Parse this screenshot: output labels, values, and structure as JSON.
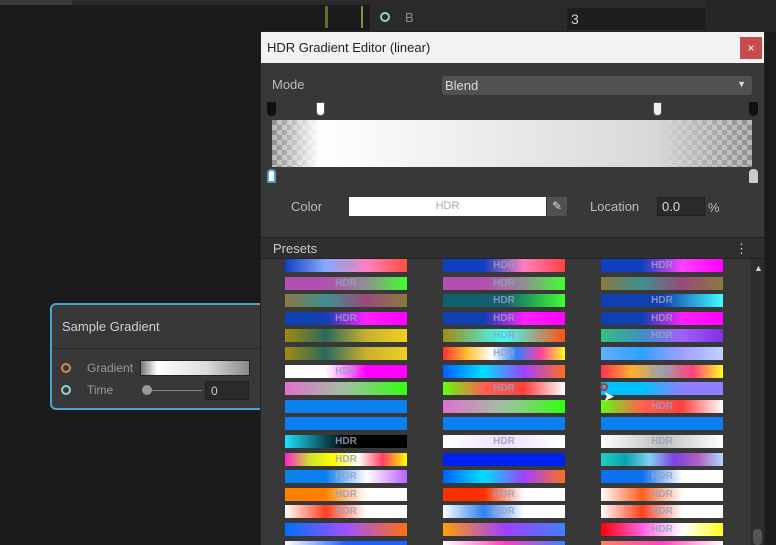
{
  "inspector": {
    "port_label": "B",
    "value": "3"
  },
  "node": {
    "title": "Sample Gradient",
    "inputs": [
      {
        "label": "Gradient",
        "port_color": "#d98a4a"
      },
      {
        "label": "Time",
        "port_color": "#8fd3d0",
        "value": "0"
      }
    ]
  },
  "editor": {
    "title": "HDR Gradient Editor (linear)",
    "close_icon": "×",
    "mode_label": "Mode",
    "mode_value": "Blend",
    "color_label": "Color",
    "color_value_text": "HDR",
    "color_value": "#ffffff",
    "location_label": "Location",
    "location_value": "0.0",
    "location_unit": "%",
    "presets_label": "Presets",
    "presets_menu_icon": "⋮",
    "gradient_colors": [
      "#ffffff",
      "#d8d8d8"
    ],
    "alpha_keys": [
      0,
      10,
      80,
      100
    ],
    "color_keys": [
      0,
      100
    ]
  },
  "presets": [
    [
      {
        "c": [
          "#1040c0",
          "#88a8ff",
          "#ff80c0",
          "#ff5040"
        ],
        "h": "HDR"
      },
      {
        "c": [
          "#1040c0",
          "#1040c0",
          "#ff80c0",
          "#ff4040"
        ],
        "h": "HDR"
      },
      {
        "c": [
          "#1040c0",
          "#1040c0",
          "#ff40ff",
          "#ff00ff"
        ],
        "h": "HDR"
      }
    ],
    [
      {
        "c": [
          "#b050b0",
          "#b050b0",
          "#909090",
          "#40ff30"
        ],
        "h": "HDR"
      },
      {
        "c": [
          "#b050b0",
          "#b050b0",
          "#909090",
          "#40ff30"
        ],
        "h": "HDR"
      },
      {
        "c": [
          "#8a7a40",
          "#3f8f8f",
          "#9a4a7a",
          "#8a7a40"
        ],
        "h": ""
      }
    ],
    [
      {
        "c": [
          "#8a7a40",
          "#3f8f8f",
          "#9a4a7a",
          "#8a7a40"
        ],
        "h": ""
      },
      {
        "c": [
          "#106070",
          "#106070",
          "#40ff30"
        ],
        "h": "HDR"
      },
      {
        "c": [
          "#1040b0",
          "#1040b0",
          "#40ffff"
        ],
        "h": "HDR"
      }
    ],
    [
      {
        "c": [
          "#1040b0",
          "#1040b0",
          "#ff20ff",
          "#ff00ff"
        ],
        "h": "HDR"
      },
      {
        "c": [
          "#1040b0",
          "#1040b0",
          "#ff20ff",
          "#ff00ff"
        ],
        "h": "HDR"
      },
      {
        "c": [
          "#1040b0",
          "#1040b0",
          "#ff20ff",
          "#ff00ff"
        ],
        "h": "HDR"
      }
    ],
    [
      {
        "c": [
          "#a08a10",
          "#2a6a5a",
          "#c8b030",
          "#f0d020"
        ],
        "h": ""
      },
      {
        "c": [
          "#a08a10",
          "#40ffff",
          "#ff5010"
        ],
        "h": "HDR"
      },
      {
        "c": [
          "#30c080",
          "#4090c0",
          "#a060ff",
          "#8030e0"
        ],
        "h": "HDR"
      }
    ],
    [
      {
        "c": [
          "#a08a10",
          "#2a6a5a",
          "#c8b030",
          "#f0d020"
        ],
        "h": ""
      },
      {
        "c": [
          "#ff3030",
          "#ffc030",
          "#ffffff",
          "#3080ff",
          "#ff40a0",
          "#ffff20"
        ],
        "h": "HDR"
      },
      {
        "c": [
          "#60b0ff",
          "#30a0ff",
          "#a0a0ff",
          "#c0d0ff"
        ],
        "h": ""
      }
    ],
    [
      {
        "c": [
          "#ffffff",
          "#ffffff",
          "#ff00ff",
          "#ff00ff"
        ],
        "h": "HDR"
      },
      {
        "c": [
          "#0060ff",
          "#00e0ff",
          "#a040ff",
          "#ff7020"
        ],
        "h": ""
      },
      {
        "c": [
          "#ff3050",
          "#ffb030",
          "#a0a0a0",
          "#ff4080",
          "#ffff20"
        ],
        "h": "HDR"
      }
    ],
    [
      {
        "c": [
          "#e070d0",
          "#a0c0a0",
          "#30ff10"
        ],
        "h": ""
      },
      {
        "c": [
          "#60ff10",
          "#ff6050",
          "#ff4040",
          "#ffffff"
        ],
        "h": "HDR"
      },
      {
        "c": [
          "#00c0ff",
          "#00c0ff",
          "#9080ff",
          "#9080ff"
        ],
        "h": ""
      }
    ],
    [
      {
        "c": [
          "#0a80f0",
          "#0a80f0"
        ],
        "h": ""
      },
      {
        "c": [
          "#e070d0",
          "#a0c0a0",
          "#30ff10"
        ],
        "h": ""
      },
      {
        "c": [
          "#60ff10",
          "#ff6050",
          "#ff4040",
          "#ffffff"
        ],
        "h": "HDR"
      }
    ],
    [
      {
        "c": [
          "#0a80f0",
          "#0a80f0"
        ],
        "h": ""
      },
      {
        "c": [
          "#0a80f0",
          "#0a80f0"
        ],
        "h": ""
      },
      {
        "c": [
          "#0a80f0",
          "#0a80f0"
        ],
        "h": ""
      }
    ],
    [
      {
        "c": [
          "#20e0ff",
          "#000000",
          "#000000"
        ],
        "h": "HDR"
      },
      {
        "c": [
          "#ffffff",
          "#f0e0ff",
          "#ffffff"
        ],
        "h": "HDR"
      },
      {
        "c": [
          "#ffffff",
          "#c0c0c0",
          "#ffffff"
        ],
        "h": "HDR"
      }
    ],
    [
      {
        "c": [
          "#ff20d0",
          "#d0e030",
          "#ffff00",
          "#ffffff",
          "#ff4060",
          "#ffff00"
        ],
        "h": "HDR"
      },
      {
        "c": [
          "#0022ee",
          "#0022ee"
        ],
        "h": ""
      },
      {
        "c": [
          "#20d0c0",
          "#10a0b0",
          "#80d0f0",
          "#8040e0",
          "#b060c0",
          "#b0d8ff"
        ],
        "h": ""
      }
    ],
    [
      {
        "c": [
          "#0a80f0",
          "#0a80f0",
          "#ffffff",
          "#c060ff"
        ],
        "h": "HDR"
      },
      {
        "c": [
          "#0060ff",
          "#00e0ff",
          "#a040ff",
          "#ff7020"
        ],
        "h": ""
      },
      {
        "c": [
          "#0a70f0",
          "#0a70f0",
          "#ffffff",
          "#ffffff"
        ],
        "h": "HDR"
      }
    ],
    [
      {
        "c": [
          "#ff8000",
          "#ff8000",
          "#ffffff",
          "#ffffff"
        ],
        "h": "HDR"
      },
      {
        "c": [
          "#ff3000",
          "#ff3000",
          "#ffffff",
          "#ffffff"
        ],
        "h": "HDR"
      },
      {
        "c": [
          "#ffffff",
          "#ff6020",
          "#ffffff",
          "#ffffff"
        ],
        "h": "HDR"
      }
    ],
    [
      {
        "c": [
          "#ffffff",
          "#ff4020",
          "#ffffff",
          "#ffffff"
        ],
        "h": "HDR"
      },
      {
        "c": [
          "#ffffff",
          "#3080f0",
          "#ffffff",
          "#ffffff"
        ],
        "h": "HDR"
      },
      {
        "c": [
          "#ffffff",
          "#ff4020",
          "#ffffff",
          "#ffffff"
        ],
        "h": "HDR"
      }
    ],
    [
      {
        "c": [
          "#0070ff",
          "#a050ff",
          "#ff7010"
        ],
        "h": ""
      },
      {
        "c": [
          "#ffa000",
          "#a040ff",
          "#4080ff"
        ],
        "h": ""
      },
      {
        "c": [
          "#ff0000",
          "#ff60e0",
          "#ffffff",
          "#ffff20"
        ],
        "h": "HDR"
      }
    ],
    [
      {
        "c": [
          "#ffffff",
          "#2060ff",
          "#2060ff"
        ],
        "h": ""
      },
      {
        "c": [
          "#ffffff",
          "#ff40c0",
          "#4080ff"
        ],
        "h": ""
      },
      {
        "c": [
          "#ff8060",
          "#ff40c0",
          "#ffffff"
        ],
        "h": ""
      }
    ]
  ],
  "colors": {
    "accent": "#4aa3d8",
    "close": "#c94a4a"
  }
}
